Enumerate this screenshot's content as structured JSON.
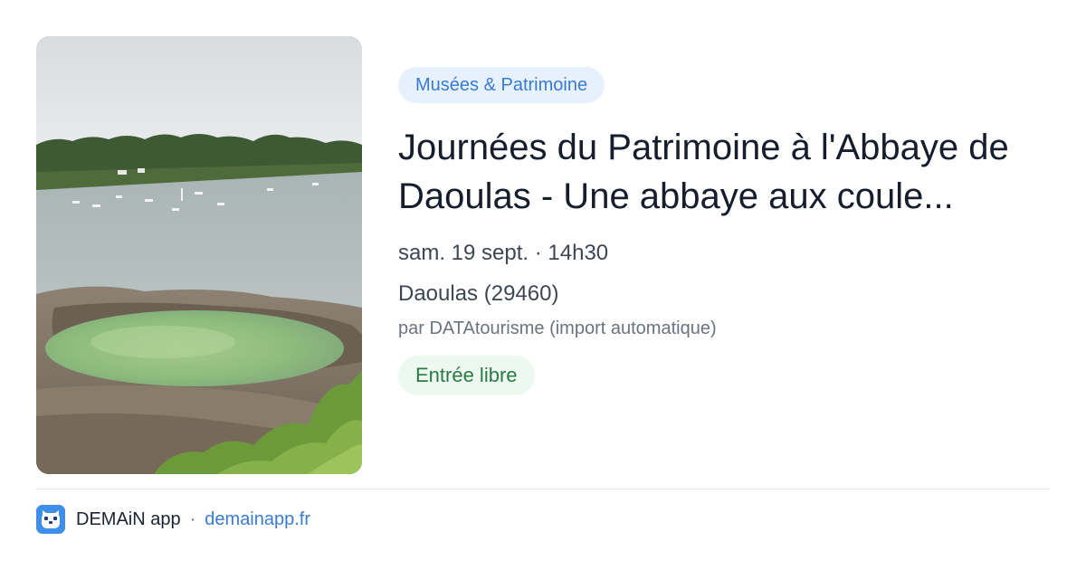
{
  "event": {
    "category": "Musées & Patrimoine",
    "title": "Journées du Patrimoine à l'Abbaye de Daoulas - Une abbaye aux coule...",
    "date_time": "sam. 19 sept. · 14h30",
    "location": "Daoulas (29460)",
    "source": "par DATAtourisme (import automatique)",
    "price": "Entrée libre"
  },
  "footer": {
    "app_name": "DEMAiN app",
    "separator": "·",
    "domain": "demainapp.fr"
  },
  "colors": {
    "category_bg": "#e7f1fd",
    "category_text": "#3a7bd0",
    "price_bg": "#edf9f0",
    "price_text": "#2b7a45",
    "brand": "#3f8ee8"
  },
  "icons": {
    "app_logo": "demain-logo-icon"
  }
}
